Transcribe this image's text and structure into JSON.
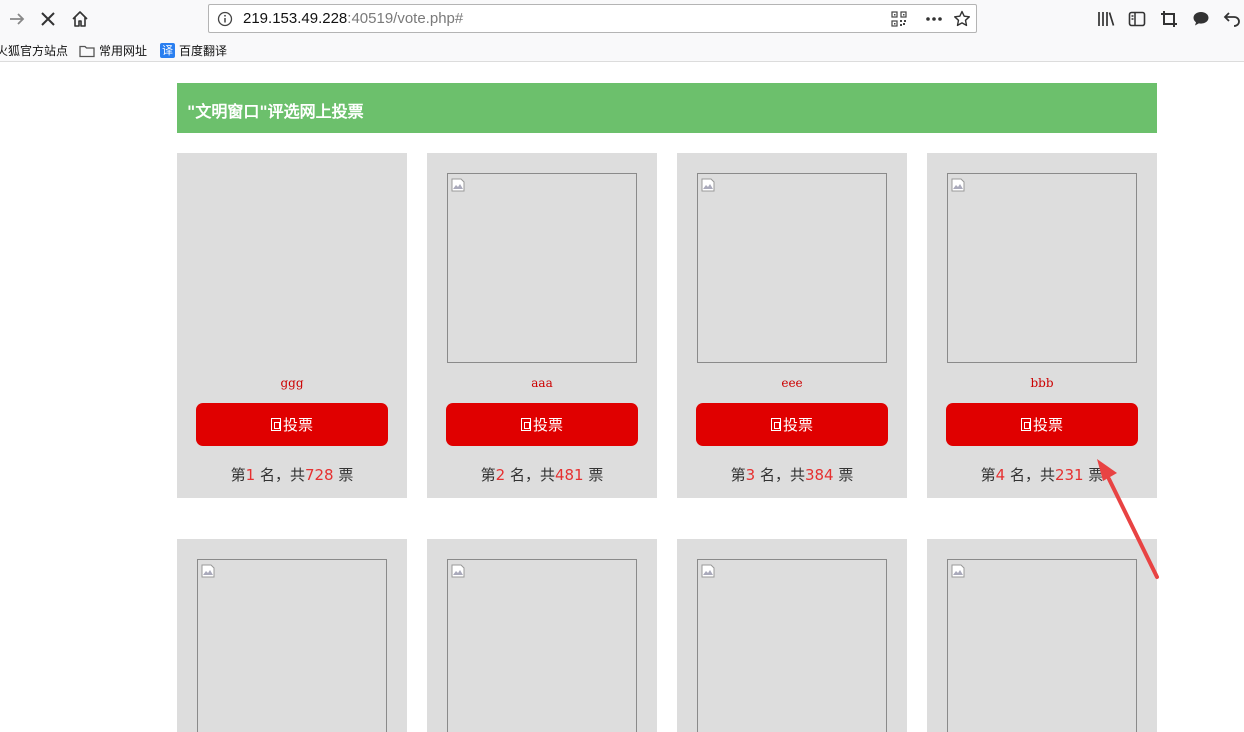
{
  "browser": {
    "url_host": "219.153.49.228",
    "url_rest": ":40519/vote.php#",
    "bookmarks": [
      {
        "label": "火狐官方站点",
        "icon": "firefox-icon"
      },
      {
        "label": "常用网址",
        "icon": "folder-icon"
      },
      {
        "label": "百度翻译",
        "icon": "translate-icon",
        "icon_text": "译"
      }
    ]
  },
  "page": {
    "title": "\"文明窗口\"评选网上投票"
  },
  "labels": {
    "vote_button": "投票",
    "rank_prefix": "第",
    "rank_middle": " 名，共",
    "rank_suffix": " 票"
  },
  "candidates": [
    {
      "name": "ggg",
      "rank": "1",
      "votes": "728"
    },
    {
      "name": "aaa",
      "rank": "2",
      "votes": "481"
    },
    {
      "name": "eee",
      "rank": "3",
      "votes": "384"
    },
    {
      "name": "bbb",
      "rank": "4",
      "votes": "231"
    }
  ],
  "colors": {
    "banner": "#6cc06c",
    "vote_button": "#e00000",
    "card_bg": "#dddddd",
    "highlight_number": "#e63030",
    "annotation_arrow": "#e84343"
  }
}
